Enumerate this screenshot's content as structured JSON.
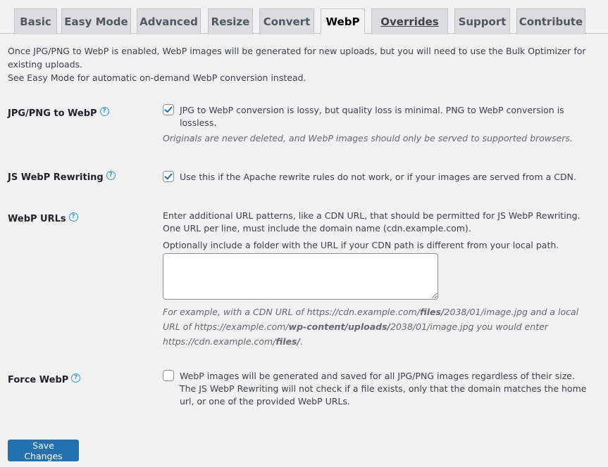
{
  "tabs": [
    {
      "label": "Basic",
      "state": "inactive"
    },
    {
      "label": "Easy Mode",
      "state": "inactive"
    },
    {
      "label": "Advanced",
      "state": "inactive"
    },
    {
      "label": "Resize",
      "state": "inactive"
    },
    {
      "label": "Convert",
      "state": "inactive"
    },
    {
      "label": "WebP",
      "state": "active"
    },
    {
      "label": "Overrides",
      "state": "inactive"
    },
    {
      "label": "Support",
      "state": "inactive"
    },
    {
      "label": "Contribute",
      "state": "inactive"
    }
  ],
  "intro": {
    "line1": "Once JPG/PNG to WebP is enabled, WebP images will be generated for new uploads, but you will need to use the Bulk Optimizer for existing uploads.",
    "line2": "See Easy Mode for automatic on-demand WebP conversion instead."
  },
  "settings": {
    "jpg_png_webp": {
      "label": "JPG/PNG to WebP",
      "checked": true,
      "text": "JPG to WebP conversion is lossy, but quality loss is minimal. PNG to WebP conversion is lossless.",
      "desc": "Originals are never deleted, and WebP images should only be served to supported browsers."
    },
    "js_webp": {
      "label": "JS WebP Rewriting",
      "checked": true,
      "text": "Use this if the Apache rewrite rules do not work, or if your images are served from a CDN."
    },
    "webp_urls": {
      "label": "WebP URLs",
      "text1": "Enter additional URL patterns, like a CDN URL, that should be permitted for JS WebP Rewriting. One URL per line, must include the domain name (cdn.example.com).",
      "text2": "Optionally include a folder with the URL if your CDN path is different from your local path.",
      "value": "",
      "example": {
        "p1": "For example, with a CDN URL of https://cdn.example.com/",
        "b1": "files/",
        "p2": "2038/01/image.jpg and a local URL of https://example.com/",
        "b2": "wp-content/uploads/",
        "p3": "2038/01/image.jpg you would enter https://cdn.example.com/",
        "b3": "files/",
        "p4": "."
      }
    },
    "force_webp": {
      "label": "Force WebP",
      "checked": false,
      "text": "WebP images will be generated and saved for all JPG/PNG images regardless of their size. The JS WebP Rewriting will not check if a file exists, only that the domain matches the home url, or one of the provided WebP URLs."
    }
  },
  "help_glyph": "?",
  "save_label": "Save Changes",
  "colors": {
    "accent": "#2271b1",
    "help": "#2ea2cc",
    "background": "#f1f1f1"
  }
}
